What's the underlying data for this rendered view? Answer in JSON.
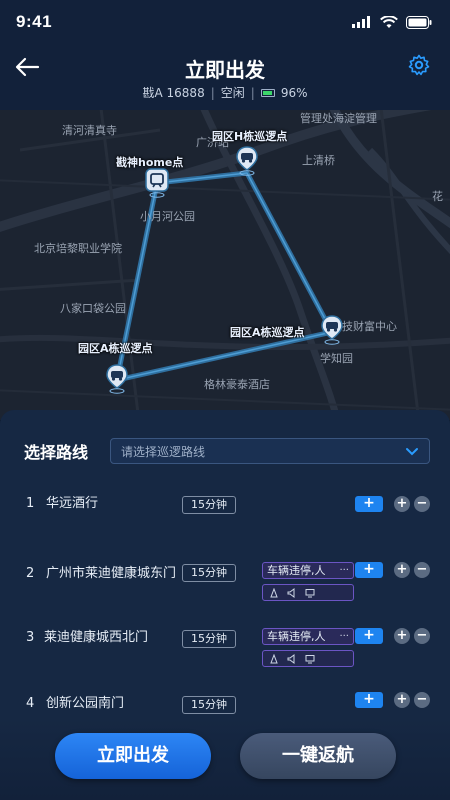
{
  "status_bar": {
    "time": "9:41"
  },
  "header": {
    "title": "立即出发",
    "plate": "戡A 16888",
    "state": "空闲",
    "battery": "96%",
    "battery_level": 0.96
  },
  "map": {
    "labels": {
      "l1": "清河清真寺",
      "l2": "广济站",
      "l3": "管理处海淀管理",
      "l4": "上清桥",
      "l5": "小月河公园",
      "l6": "北京培黎职业学院",
      "l7": "八家口袋公园",
      "l8": "技财富中心",
      "l9": "学知园",
      "l10": "格林豪泰酒店",
      "l11": "花"
    },
    "points": {
      "home": "戡神home点",
      "h": "园区H栋巡逻点",
      "a_right": "园区A栋巡逻点",
      "a_left": "园区A栋巡逻点"
    }
  },
  "panel": {
    "select_label": "选择路线",
    "select_placeholder": "请选择巡逻路线",
    "routes": [
      {
        "index": "1",
        "name": "华远酒行",
        "duration": "15分钟"
      },
      {
        "index": "2",
        "name": "广州市莱迪健康城东门",
        "duration": "15分钟",
        "task": "车辆违停,人",
        "more": "···"
      },
      {
        "index": "3",
        "name": "莱迪健康城西北门",
        "duration": "15分钟",
        "task": "车辆违停,人",
        "more": "···"
      },
      {
        "index": "4",
        "name": "创新公园南门",
        "duration": "15分钟"
      }
    ],
    "plus": "+",
    "minus": "−"
  },
  "actions": {
    "start": "立即出发",
    "return": "一键返航"
  },
  "colors": {
    "accent": "#1e84f0",
    "route_line": "#2f6f9f",
    "chip_border": "#6b55c4"
  }
}
